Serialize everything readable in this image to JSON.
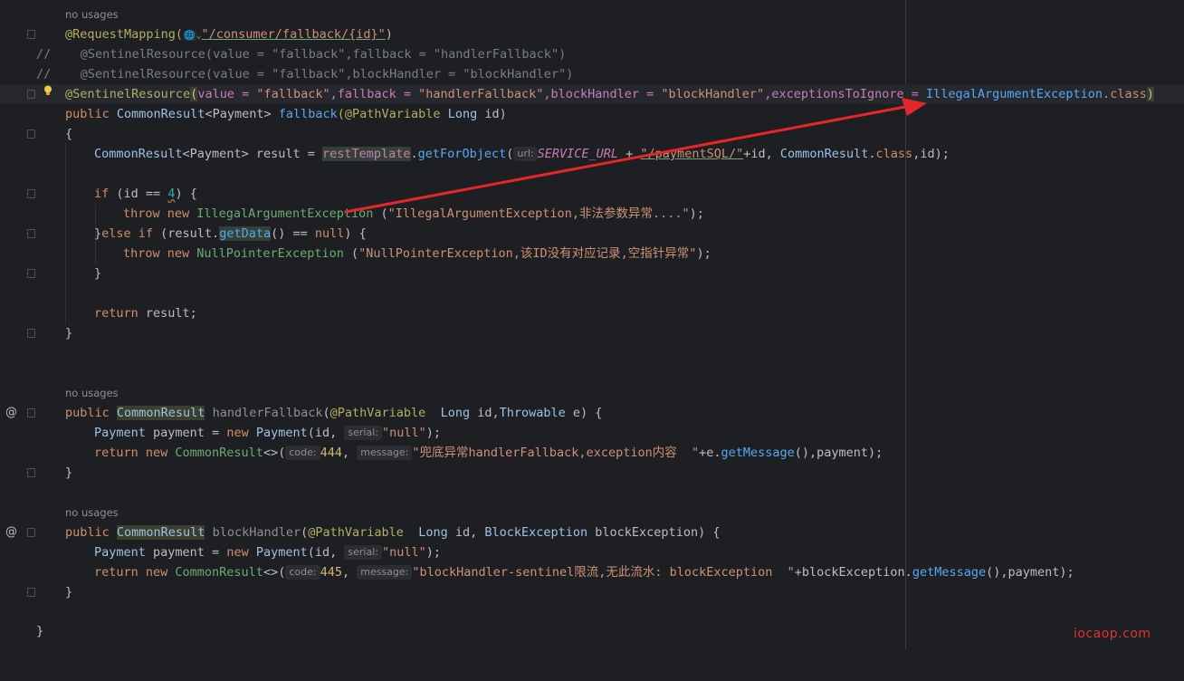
{
  "hints": {
    "usages1": "no usages",
    "usages2": "no usages",
    "usages3": "no usages"
  },
  "lines": {
    "l1": {
      "ann": "@RequestMapping(",
      "globe": "🌐",
      "chev": "⌄",
      "str": "\"/consumer/fallback/{id}\"",
      "close": ")"
    },
    "l2": "//    @SentinelResource(value = \"fallback\",fallback = \"handlerFallback\")",
    "l3": "//    @SentinelResource(value = \"fallback\",blockHandler = \"blockHandler\")",
    "l4": {
      "a": "@SentinelResource",
      "p1": "(",
      "b": "value = ",
      "c": "\"fallback\"",
      "d": ",fallback = ",
      "e": "\"handlerFallback\"",
      "f": ",blockHandler = ",
      "g": "\"blockHandler\"",
      "h": ",exceptionsToIgnore = ",
      "i": "IllegalArgumentException",
      "j": ".class",
      "k": ")"
    },
    "l5": {
      "a": "public ",
      "b": "CommonResult",
      "c": "<Payment> ",
      "d": "fallback",
      "e": "(@PathVariable ",
      "f": "Long",
      "g": " id)"
    },
    "l6": "{",
    "l7": {
      "a": "CommonResult",
      "b": "<Payment> result = ",
      "c": "restTemplate",
      "d": ".",
      "e": "getForObject",
      "f": "(",
      "hint": "url:",
      "g": "SERVICE_URL",
      "h": " + ",
      "i": "\"/paymentSQL/\"",
      "j": "+id, ",
      "k": "CommonResult",
      "l": ".",
      "m": "class",
      "n": ",id);"
    },
    "l8": {
      "a": "if ",
      "b": "(id == ",
      "c": "4",
      "d": ") {"
    },
    "l9": {
      "a": "throw new ",
      "b": "IllegalArgumentException",
      "c": " (",
      "d": "\"IllegalArgumentException,非法参数异常....\"",
      "e": ");"
    },
    "l10": {
      "a": "}",
      "b": "else if ",
      "c": "(result.",
      "d": "getData",
      "e": "() == ",
      "f": "null",
      "g": ") {"
    },
    "l11": {
      "a": "throw new ",
      "b": "NullPointerException",
      "c": " (",
      "d": "\"NullPointerException,该ID没有对应记录,空指针异常\"",
      "e": ");"
    },
    "l12": "}",
    "l13": {
      "a": "return ",
      "b": "result;"
    },
    "l14": "}",
    "l15": {
      "a": "public ",
      "b": "CommonResult",
      "c": " handlerFallback",
      "d": "(",
      "e": "@PathVariable",
      "f": "  Long ",
      "g": "id,",
      "h": "Throwable",
      "i": " e) {"
    },
    "l16": {
      "a": "Payment",
      "b": " payment = ",
      "c": "new ",
      "d": "Payment",
      "e": "(id, ",
      "hint": "serial:",
      "f": "\"null\"",
      "g": ");"
    },
    "l17": {
      "a": "return new ",
      "b": "CommonResult",
      "c": "<>(",
      "hint1": "code:",
      "d": "444",
      "e": ", ",
      "hint2": "message:",
      "f": "\"兜底异常handlerFallback,exception内容  \"",
      "g": "+e.",
      "h": "getMessage",
      "i": "(),payment);"
    },
    "l18": "}",
    "l19": {
      "a": "public ",
      "b": "CommonResult",
      "c": " blockHandler",
      "d": "(",
      "e": "@PathVariable",
      "f": "  Long ",
      "g": "id, ",
      "h": "BlockException",
      "i": " blockException) {"
    },
    "l20": {
      "a": "Payment",
      "b": " payment = ",
      "c": "new ",
      "d": "Payment",
      "e": "(id, ",
      "hint": "serial:",
      "f": "\"null\"",
      "g": ");"
    },
    "l21": {
      "a": "return new ",
      "b": "CommonResult",
      "c": "<>(",
      "hint1": "code:",
      "d": "445",
      "e": ", ",
      "hint2": "message:",
      "f": "\"blockHandler-sentinel限流,无此流水: blockException  \"",
      "g": "+blockException.",
      "h": "getMessage",
      "i": "(),payment);"
    },
    "l22": "}",
    "l23": "}"
  },
  "gutter_markers": {
    "at1": "@",
    "at2": "@"
  },
  "watermark": "iocaop.com",
  "colors": {
    "background": "#1e1f22",
    "arrow": "#e5262a",
    "keyword": "#cf8e6d",
    "string": "#6aab73",
    "annotation": "#b3ae60"
  }
}
